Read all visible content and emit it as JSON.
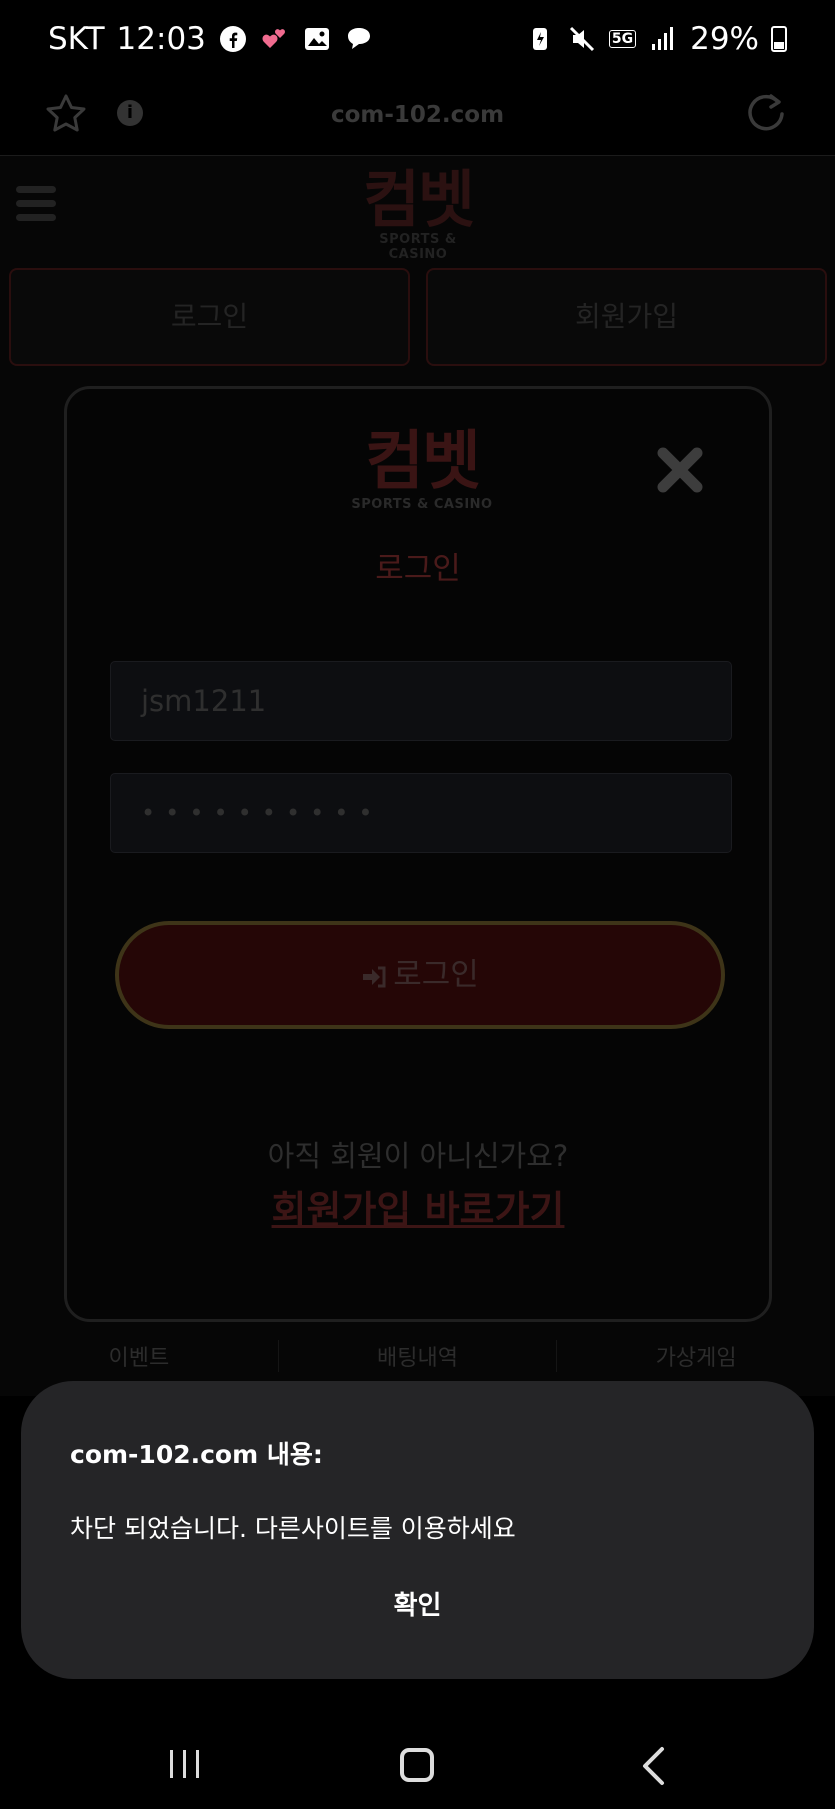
{
  "status_bar": {
    "carrier": "SKT",
    "time": "12:03",
    "network": "5G",
    "battery": "29%"
  },
  "browser": {
    "url": "com-102.com"
  },
  "page": {
    "logo_main": "컴벳",
    "logo_sub": "SPORTS & CASINO",
    "login_button": "로그인",
    "join_button": "회원가입",
    "menu": [
      "이벤트",
      "배팅내역",
      "가상게임"
    ]
  },
  "modal": {
    "logo_main": "컴벳",
    "logo_sub": "SPORTS & CASINO",
    "title": "로그인",
    "username_value": "jsm1211",
    "password_value": "••••••••••",
    "login_button": "로그인",
    "question": "아직 회원이 아니신가요?",
    "join_link": "회원가입 바로가기"
  },
  "dialog": {
    "title": "com-102.com 내용:",
    "message": "차단 되었습니다. 다른사이트를 이용하세요",
    "ok_label": "확인"
  },
  "colors": {
    "dialog_bg": "#252527",
    "accent_red": "#250606"
  }
}
